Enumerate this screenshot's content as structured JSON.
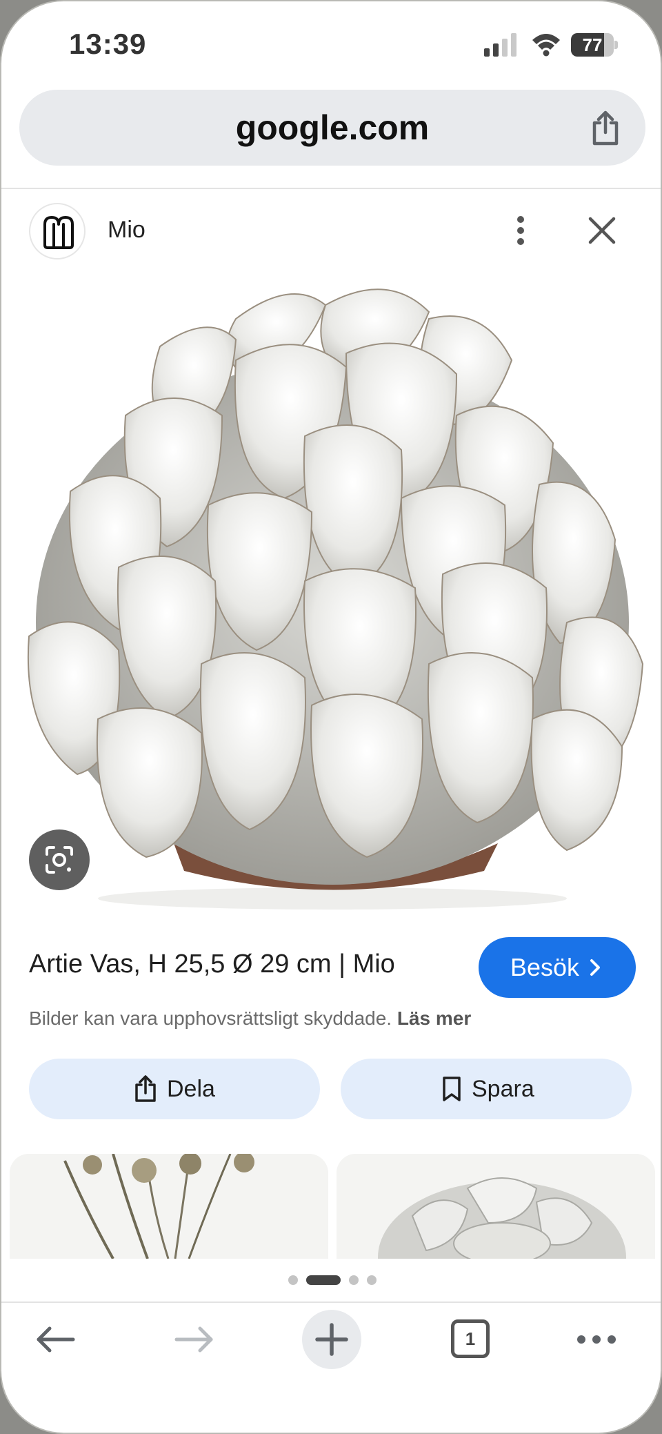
{
  "status_bar": {
    "time": "13:39",
    "battery": "77",
    "battery_level": 0.77,
    "icons": [
      "signal-icon",
      "wifi-icon",
      "battery-icon"
    ]
  },
  "address_bar": {
    "url": "google.com",
    "share_icon": "share-icon"
  },
  "source": {
    "name": "Mio",
    "logo_icon": "mio-logo",
    "more_icon": "more-vertical-icon",
    "close_icon": "close-icon"
  },
  "image": {
    "lens_icon": "lens-icon"
  },
  "result": {
    "title": "Artie Vas, H 25,5 Ø 29 cm | Mio",
    "visit_label": "Besök",
    "copyright_text": "Bilder kan vara upphovsrättsligt skyddade.",
    "read_more": "Läs mer"
  },
  "actions": {
    "share_label": "Dela",
    "save_label": "Spara"
  },
  "pager": {
    "total": 4,
    "active_index": 1
  },
  "toolbar": {
    "tab_count": "1",
    "icons": [
      "back-arrow-icon",
      "forward-arrow-icon",
      "plus-icon",
      "tabs-icon",
      "more-horizontal-icon"
    ]
  },
  "colors": {
    "accent": "#1a73e8",
    "chip_background": "#e3edfb",
    "address_bar": "#e8eaed"
  }
}
